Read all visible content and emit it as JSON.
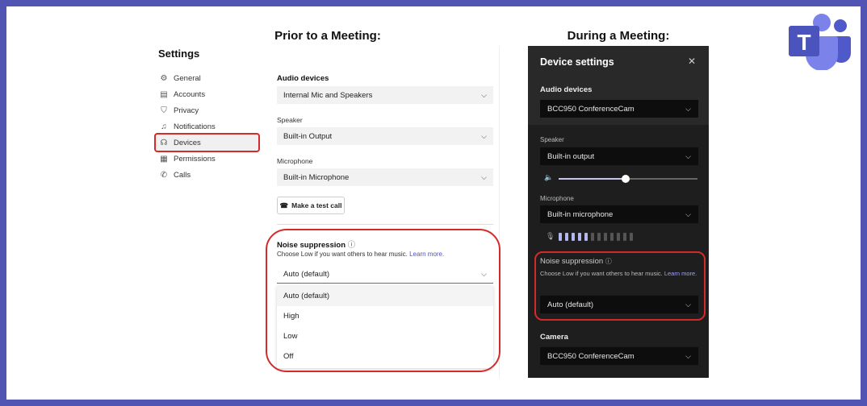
{
  "headings": {
    "left": "Prior to a Meeting:",
    "right": "During a Meeting:"
  },
  "light": {
    "title": "Settings",
    "nav": [
      {
        "label": "General",
        "icon": "gear-icon",
        "glyph": "⚙"
      },
      {
        "label": "Accounts",
        "icon": "id-card-icon",
        "glyph": "▤"
      },
      {
        "label": "Privacy",
        "icon": "shield-icon",
        "glyph": "⛉"
      },
      {
        "label": "Notifications",
        "icon": "bell-icon",
        "glyph": "♫"
      },
      {
        "label": "Devices",
        "icon": "headset-icon",
        "glyph": "☊"
      },
      {
        "label": "Permissions",
        "icon": "grid-icon",
        "glyph": "▦"
      },
      {
        "label": "Calls",
        "icon": "phone-icon",
        "glyph": "✆"
      }
    ],
    "audio_devices_label": "Audio devices",
    "audio_device_value": "Internal Mic and Speakers",
    "speaker_label": "Speaker",
    "speaker_value": "Built-in Output",
    "microphone_label": "Microphone",
    "microphone_value": "Built-in Microphone",
    "test_call_label": "Make a test call",
    "noise_label": "Noise suppression",
    "noise_desc": "Choose Low if you want others to hear music.",
    "learn_more": "Learn more.",
    "noise_value": "Auto (default)",
    "options": [
      "Auto (default)",
      "High",
      "Low",
      "Off"
    ]
  },
  "dark": {
    "title": "Device settings",
    "audio_devices_label": "Audio devices",
    "audio_device_value": "BCC950 ConferenceCam",
    "speaker_label": "Speaker",
    "speaker_value": "Built-in output",
    "volume_level": 0.48,
    "microphone_label": "Microphone",
    "microphone_value": "Built-in microphone",
    "mic_level_bars_on": 5,
    "mic_level_bars_total": 12,
    "noise_label": "Noise suppression",
    "noise_desc": "Choose Low if you want others to hear music.",
    "learn_more": "Learn more.",
    "noise_value": "Auto (default)",
    "camera_label": "Camera",
    "camera_value": "BCC950 ConferenceCam"
  },
  "colors": {
    "border": "#5254b3",
    "highlight": "#d32b2b",
    "accent": "#5b5fc7"
  },
  "logo": {
    "letter": "T"
  }
}
